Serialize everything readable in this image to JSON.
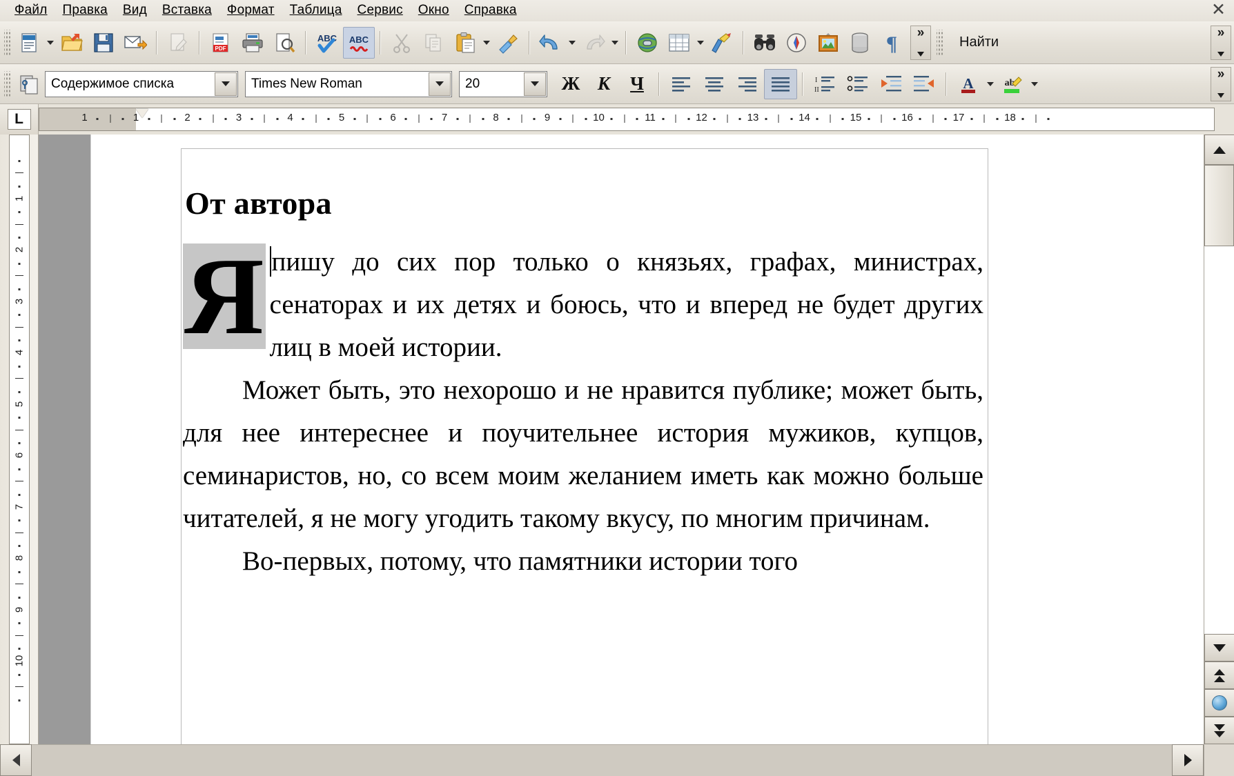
{
  "window": {
    "close_label": "✕"
  },
  "menubar": {
    "items": [
      {
        "label": "Файл",
        "accel": "Ф"
      },
      {
        "label": "Правка",
        "accel": "П"
      },
      {
        "label": "Вид",
        "accel": "В"
      },
      {
        "label": "Вставка",
        "accel": "т"
      },
      {
        "label": "Формат",
        "accel": "Ф"
      },
      {
        "label": "Таблица",
        "accel": "Т"
      },
      {
        "label": "Сервис",
        "accel": "е"
      },
      {
        "label": "Окно",
        "accel": "О"
      },
      {
        "label": "Справка",
        "accel": "в"
      }
    ]
  },
  "standard_toolbar": {
    "buttons": [
      {
        "name": "new-document-icon",
        "tooltip": "Создать"
      },
      {
        "name": "new-document-dropdown-icon",
        "tooltip": "Создать (список)"
      },
      {
        "name": "open-folder-icon",
        "tooltip": "Открыть"
      },
      {
        "name": "save-icon",
        "tooltip": "Сохранить"
      },
      {
        "name": "send-email-icon",
        "tooltip": "Отправить по эл. почте"
      },
      {
        "name": "edit-file-icon",
        "tooltip": "Правка документа"
      },
      {
        "name": "export-pdf-icon",
        "tooltip": "Экспорт в PDF"
      },
      {
        "name": "print-icon",
        "tooltip": "Печать"
      },
      {
        "name": "print-preview-icon",
        "tooltip": "Предварительный просмотр"
      },
      {
        "name": "spellcheck-icon",
        "tooltip": "Проверка орфографии"
      },
      {
        "name": "autospellcheck-icon",
        "tooltip": "Автопроверка орфографии"
      },
      {
        "name": "cut-icon",
        "tooltip": "Вырезать"
      },
      {
        "name": "copy-icon",
        "tooltip": "Копировать"
      },
      {
        "name": "paste-icon",
        "tooltip": "Вставить"
      },
      {
        "name": "paste-dropdown-icon",
        "tooltip": "Вставить как"
      },
      {
        "name": "clone-formatting-icon",
        "tooltip": "Копировать форматирование"
      },
      {
        "name": "undo-icon",
        "tooltip": "Отменить"
      },
      {
        "name": "undo-dropdown-icon",
        "tooltip": "Отменить (список)"
      },
      {
        "name": "redo-icon",
        "tooltip": "Вернуть"
      },
      {
        "name": "redo-dropdown-icon",
        "tooltip": "Вернуть (список)"
      },
      {
        "name": "hyperlink-icon",
        "tooltip": "Гиперссылка"
      },
      {
        "name": "insert-table-icon",
        "tooltip": "Таблица"
      },
      {
        "name": "insert-table-dropdown-icon",
        "tooltip": "Таблица (список)"
      },
      {
        "name": "drawing-functions-icon",
        "tooltip": "Функции рисования"
      },
      {
        "name": "find-replace-icon",
        "tooltip": "Найти и заменить"
      },
      {
        "name": "navigator-icon",
        "tooltip": "Навигатор"
      },
      {
        "name": "gallery-icon",
        "tooltip": "Галерея"
      },
      {
        "name": "data-sources-icon",
        "tooltip": "Источники данных"
      },
      {
        "name": "formatting-marks-icon",
        "tooltip": "Непечатаемые символы"
      }
    ],
    "overflow_label": "»",
    "find_label": "Найти"
  },
  "format_toolbar": {
    "styles_icon": "paragraph-styles-icon",
    "paragraph_style": {
      "value": "Содержимое списка"
    },
    "font_name": {
      "value": "Times New Roman"
    },
    "font_size": {
      "value": "20"
    },
    "bold_label": "Ж",
    "italic_label": "К",
    "underline_label": "Ч",
    "align_left": "align-left-icon",
    "align_center": "align-center-icon",
    "align_right": "align-right-icon",
    "align_justify": "align-justify-icon",
    "numbered_list": "numbered-list-icon",
    "bullet_list": "bullet-list-icon",
    "decrease_indent": "decrease-indent-icon",
    "increase_indent": "increase-indent-icon",
    "font_color_label": "A",
    "highlight_label": "ab",
    "overflow_label": "»"
  },
  "ruler": {
    "tab_selector_label": "L",
    "horizontal_ticks": [
      "1",
      "1",
      "2",
      "3",
      "4",
      "5",
      "6",
      "7",
      "8",
      "9",
      "10",
      "11",
      "12",
      "13",
      "14",
      "15",
      "16",
      "17",
      "18"
    ],
    "vertical_ticks": [
      "1",
      "2",
      "3",
      "4",
      "5",
      "6",
      "7",
      "8",
      "9",
      "10"
    ]
  },
  "document": {
    "heading": "От автора",
    "drop_cap": "Я",
    "paragraphs": [
      {
        "id": "p1",
        "has_dropcap": true,
        "text": "пишу до сих пор только о князьях, графах, министрах, сенаторах и их детях и боюсь, что и вперед не будет других лиц в моей истории."
      },
      {
        "id": "p2",
        "has_dropcap": false,
        "text": "Может быть, это нехорошо и не нравится публике; может быть, для нее интереснее и поучительнее история мужиков, купцов, семинаристов, но, со всем моим желанием иметь как можно больше читателей, я не могу угодить такому вкусу, по многим причинам."
      },
      {
        "id": "p3",
        "has_dropcap": false,
        "text": "Во-первых, потому, что памятники истории того"
      }
    ]
  },
  "scrollbars": {
    "v_up": "scroll-up-icon",
    "v_down": "scroll-down-icon",
    "prev_page": "previous-page-icon",
    "nav_dot": "navigation-icon",
    "next_page": "next-page-icon",
    "h_left": "scroll-left-icon",
    "h_right": "scroll-right-icon"
  },
  "colors": {
    "toolbar_bg": "#e6e2da",
    "active_button": "#c9d3e4",
    "page_bg": "#ffffff",
    "margin_gray": "#9a9a9a",
    "dropcap_highlight": "#c6c6c6",
    "text": "#000000"
  }
}
